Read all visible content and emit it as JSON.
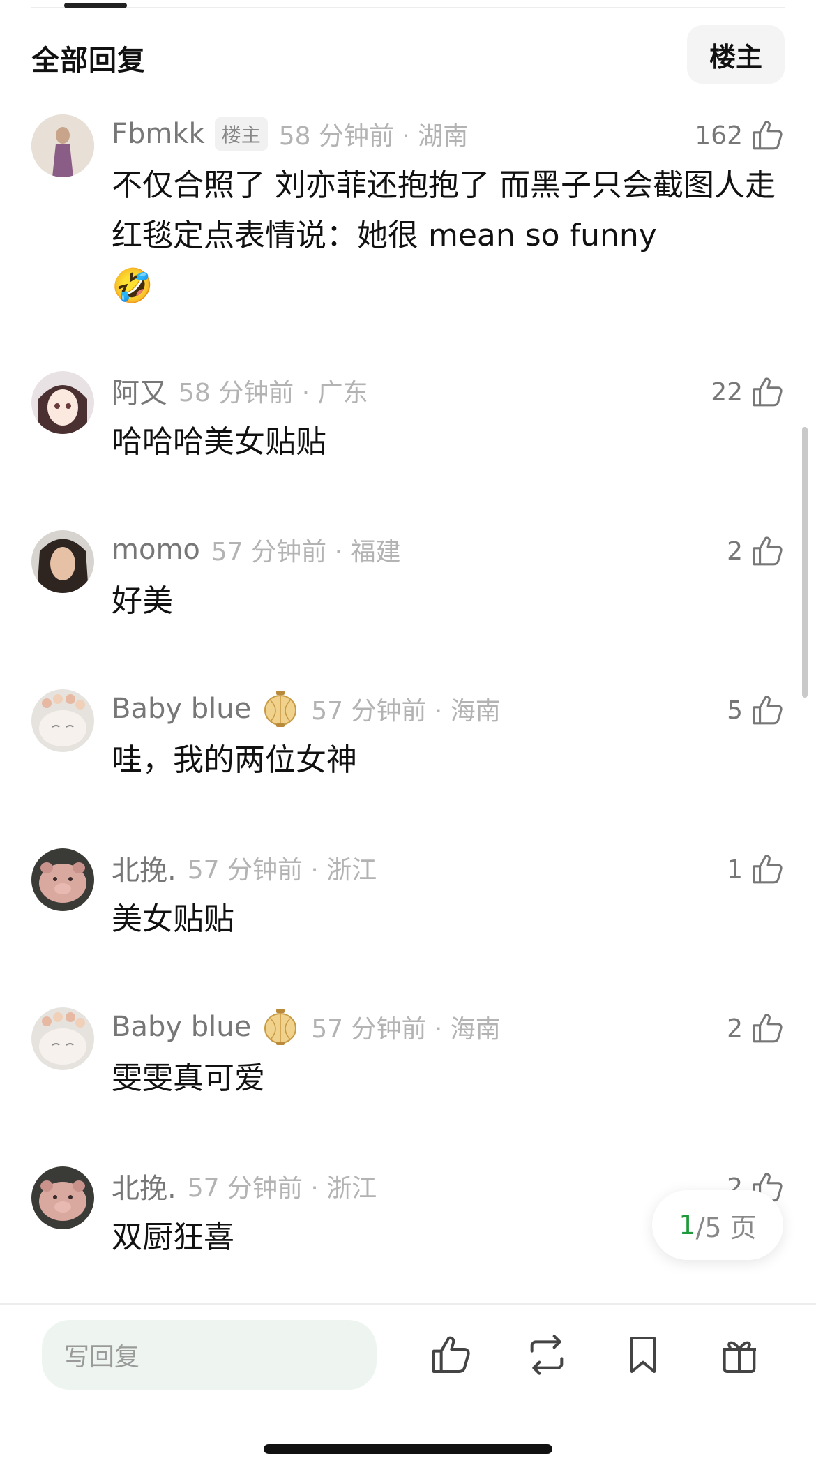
{
  "header": {
    "title": "全部回复",
    "filter_label": "楼主"
  },
  "comments": [
    {
      "username": "Fbmkk",
      "badge": "楼主",
      "time": "58 分钟前 · 湖南",
      "likes": "162",
      "content": "不仅合照了 刘亦菲还抱抱了 而黑子只会截图人走红毯定点表情说：她很 mean so funny",
      "emoji": "🤣",
      "avatar": "woman-in-purple-dress-avatar"
    },
    {
      "username": "阿又",
      "time": "58 分钟前 · 广东",
      "likes": "22",
      "content": "哈哈哈美女贴贴",
      "avatar": "anime-girl-avatar"
    },
    {
      "username": "momo",
      "time": "57 分钟前 · 福建",
      "likes": "2",
      "content": "好美",
      "avatar": "girl-portrait-avatar"
    },
    {
      "username": "Baby blue",
      "decor": "lantern-badge",
      "time": "57 分钟前 · 海南",
      "likes": "5",
      "content": "哇，我的两位女神",
      "avatar": "cat-with-flowers-avatar"
    },
    {
      "username": "北挽.",
      "time": "57 分钟前 · 浙江",
      "likes": "1",
      "content": "美女贴贴",
      "avatar": "pig-plush-avatar"
    },
    {
      "username": "Baby blue",
      "decor": "lantern-badge",
      "time": "57 分钟前 · 海南",
      "likes": "2",
      "content": "雯雯真可爱",
      "avatar": "cat-with-flowers-avatar"
    },
    {
      "username": "北挽.",
      "time": "57 分钟前 · 浙江",
      "likes": "2",
      "content": "双厨狂喜",
      "avatar": "pig-plush-avatar"
    }
  ],
  "pager": {
    "current": "1",
    "total": "/5 页"
  },
  "bottom_bar": {
    "reply_placeholder": "写回复",
    "icons": [
      "thumbs-up-icon",
      "repost-icon",
      "bookmark-icon",
      "gift-icon"
    ]
  },
  "colors": {
    "accent_green": "#1f9a3a",
    "input_bg": "#eef5f0",
    "meta_gray": "#b3b3b3"
  }
}
